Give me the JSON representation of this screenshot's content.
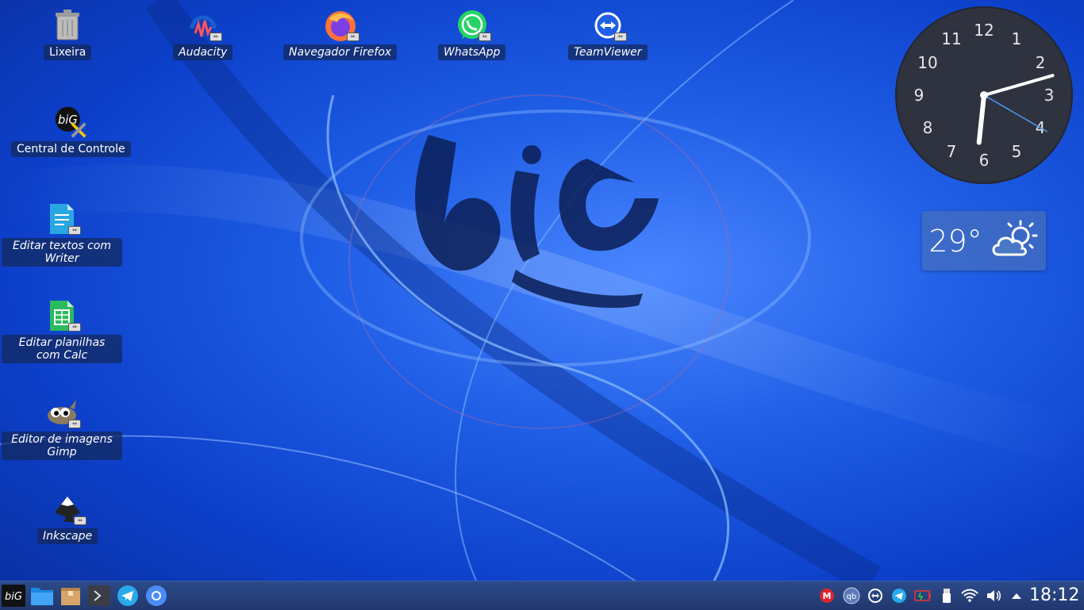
{
  "desktop": {
    "icons": [
      {
        "label": "Lixeira",
        "icon": "trash-icon"
      },
      {
        "label": "Audacity",
        "icon": "audacity-icon"
      },
      {
        "label": "Navegador Firefox",
        "icon": "firefox-icon"
      },
      {
        "label": "WhatsApp",
        "icon": "whatsapp-icon"
      },
      {
        "label": "TeamViewer",
        "icon": "teamviewer-icon"
      },
      {
        "label": "Central de Controle",
        "icon": "control-center-icon"
      },
      {
        "label": "Editar textos com Writer",
        "icon": "writer-icon"
      },
      {
        "label": "Editar planilhas com Calc",
        "icon": "calc-icon"
      },
      {
        "label": "Editor de imagens Gimp",
        "icon": "gimp-icon"
      },
      {
        "label": "Inkscape",
        "icon": "inkscape-icon"
      }
    ]
  },
  "clock_widget": {
    "numbers": [
      "12",
      "1",
      "2",
      "3",
      "4",
      "5",
      "6",
      "7",
      "8",
      "9",
      "10",
      "11"
    ],
    "time": {
      "hours": 6,
      "minutes": 12,
      "seconds": 20
    }
  },
  "weather": {
    "temperature": "29°",
    "icon": "partly-cloudy-icon"
  },
  "taskbar": {
    "launchers": [
      "big-menu-icon",
      "file-manager-icon",
      "package-icon",
      "terminal-icon",
      "telegram-icon",
      "chromium-icon"
    ],
    "tray": [
      "mega-icon",
      "qbittorrent-icon",
      "teamviewer-tray-icon",
      "telegram-tray-icon",
      "battery-icon",
      "usb-icon",
      "wifi-icon",
      "volume-icon",
      "expand-tray-icon"
    ],
    "clock": "18:12"
  },
  "colors": {
    "taskbar": "#24407a",
    "accent": "#1f5ee6"
  }
}
